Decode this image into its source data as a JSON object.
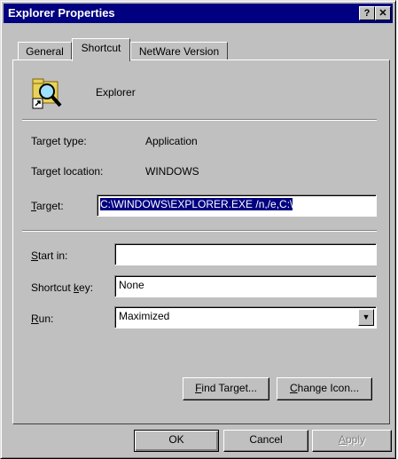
{
  "window": {
    "title": "Explorer Properties",
    "help_btn": "?",
    "close_btn": "✕"
  },
  "tabs": [
    {
      "label": "General"
    },
    {
      "label": "Shortcut"
    },
    {
      "label": "NetWare Version"
    }
  ],
  "shortcut": {
    "icon_name": "explorer-shortcut-icon",
    "name": "Explorer",
    "target_type_label": "Target type:",
    "target_type_value": "Application",
    "target_location_label": "Target location:",
    "target_location_value": "WINDOWS",
    "target_label_pre": "",
    "target_label_u": "T",
    "target_label_post": "arget:",
    "target_value": "C:\\WINDOWS\\EXPLORER.EXE /n,/e,C:\\",
    "start_in_u": "S",
    "start_in_post": "tart in:",
    "start_in_value": "",
    "shortcut_key_pre": "Shortcut ",
    "shortcut_key_u": "k",
    "shortcut_key_post": "ey:",
    "shortcut_key_value": "None",
    "run_u": "R",
    "run_post": "un:",
    "run_value": "Maximized",
    "find_target_u": "F",
    "find_target_post": "ind Target...",
    "change_icon_u": "C",
    "change_icon_post": "hange Icon..."
  },
  "footer": {
    "ok": "OK",
    "cancel": "Cancel",
    "apply_u": "A",
    "apply_post": "pply"
  }
}
